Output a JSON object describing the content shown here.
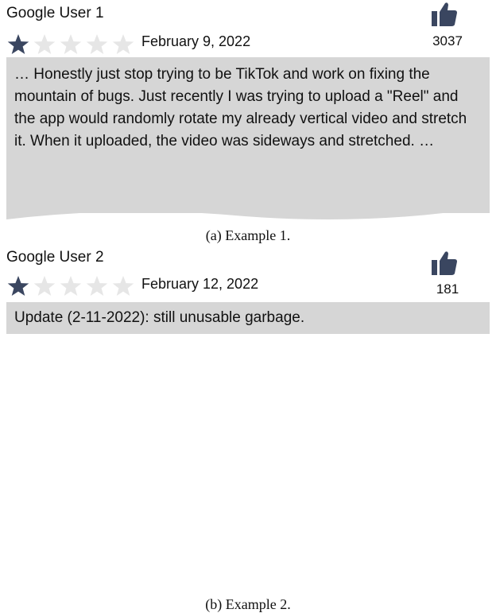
{
  "reviews": [
    {
      "user": "Google User 1",
      "rating": 1,
      "max_rating": 5,
      "date": "February 9, 2022",
      "likes": "3037",
      "text": "… Honestly just stop trying to be TikTok and work on fixing the mountain of bugs. Just recently I was trying to upload a \"Reel\" and the app would randomly rotate my already vertical video and stretch it. When it uploaded, the video was sideways and stretched. …",
      "caption": "(a) Example 1."
    },
    {
      "user": "Google User 2",
      "rating": 1,
      "max_rating": 5,
      "date": "February 12, 2022",
      "likes": "181",
      "text": "Update (2-11-2022): still unusable garbage.",
      "caption": "(b) Example 2."
    }
  ],
  "colors": {
    "star_filled": "#3a4660",
    "star_empty": "#e6e6e6",
    "thumb": "#3a4660",
    "body_background": "#d6d6d6"
  },
  "icons": {
    "star": "star-icon",
    "like": "thumbs-up-icon"
  }
}
